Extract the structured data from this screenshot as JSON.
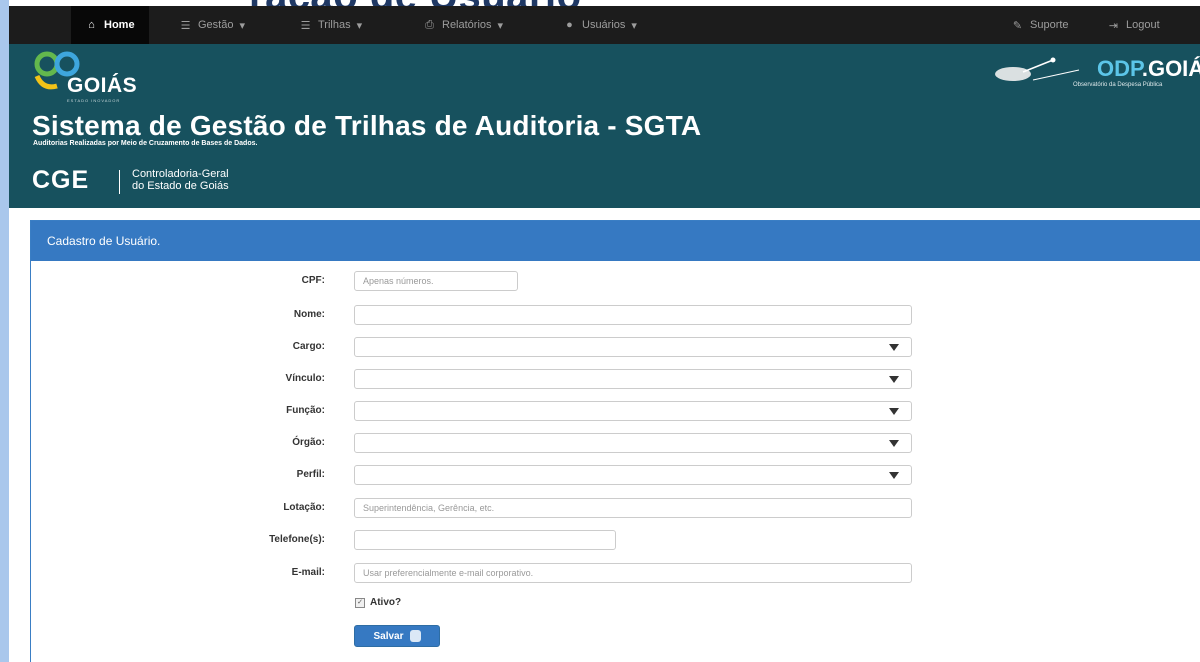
{
  "slide_title_fragment": "ração de Usuário",
  "nav": {
    "home": "Home",
    "gestao": "Gestão",
    "trilhas": "Trilhas",
    "relatorios": "Relatórios",
    "usuarios": "Usuários",
    "suporte": "Suporte",
    "logout": "Logout"
  },
  "header": {
    "state_name": "GOIÁS",
    "state_tagline": "ESTADO INOVADOR",
    "odp_brand": "ODP",
    "odp_state": ".GOIÁS",
    "odp_subtitle": "Observatório da Despesa Pública",
    "system_title": "Sistema de Gestão de Trilhas de Auditoria - SGTA",
    "system_subtitle": "Auditorias Realizadas por Meio de Cruzamento de Bases de Dados.",
    "org_acronym": "CGE",
    "org_name": "Controladoria-Geral\ndo Estado de Goiás"
  },
  "form": {
    "panel_title": "Cadastro de Usuário.",
    "fields": {
      "cpf": {
        "label": "CPF:",
        "placeholder": "Apenas números."
      },
      "nome": {
        "label": "Nome:",
        "placeholder": ""
      },
      "cargo": {
        "label": "Cargo:",
        "value": ""
      },
      "vinculo": {
        "label": "Vínculo:",
        "value": ""
      },
      "funcao": {
        "label": "Função:",
        "value": ""
      },
      "orgao": {
        "label": "Órgão:",
        "value": ""
      },
      "perfil": {
        "label": "Perfil:",
        "value": ""
      },
      "lotacao": {
        "label": "Lotação:",
        "placeholder": "Superintendência, Gerência, etc."
      },
      "telefone": {
        "label": "Telefone(s):",
        "placeholder": ""
      },
      "email": {
        "label": "E-mail:",
        "placeholder": "Usar preferencialmente e-mail corporativo."
      }
    },
    "ativo_label": "Ativo?",
    "ativo_checked": true,
    "save_label": "Salvar"
  },
  "colors": {
    "navbar": "#1c1c1c",
    "header": "#17515e",
    "panel_accent": "#3679c2",
    "annotation_arrow": "#e0202a"
  }
}
